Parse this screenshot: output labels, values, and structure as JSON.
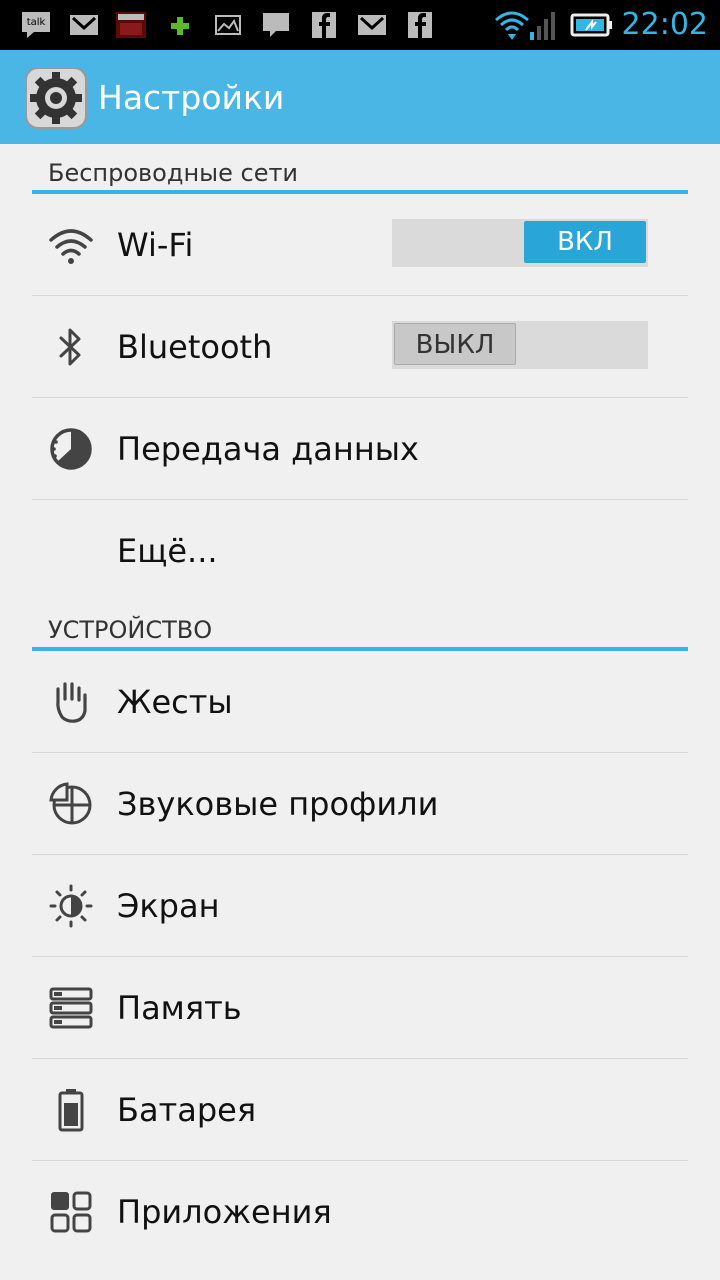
{
  "status_bar": {
    "time": "22:02",
    "accent": "#33b5e5",
    "notifications": [
      "talk-icon",
      "gmail-icon",
      "video-icon",
      "plus-icon",
      "gallery-icon",
      "message-icon",
      "facebook-icon",
      "gmail-icon",
      "facebook-icon"
    ]
  },
  "action_bar": {
    "title": "Настройки",
    "color": "#4ab6e6"
  },
  "sections": {
    "wireless": {
      "header": "Беспроводные сети",
      "wifi": {
        "label": "Wi-Fi",
        "toggle": "ВКЛ",
        "state": "on"
      },
      "bluetooth": {
        "label": "Bluetooth",
        "toggle": "ВЫКЛ",
        "state": "off"
      },
      "data": {
        "label": "Передача данных"
      },
      "more": {
        "label": "Ещё..."
      }
    },
    "device": {
      "header": "УСТРОЙСТВО",
      "gestures": {
        "label": "Жесты"
      },
      "sound": {
        "label": "Звуковые профили"
      },
      "screen": {
        "label": "Экран"
      },
      "memory": {
        "label": "Память"
      },
      "battery": {
        "label": "Батарея"
      },
      "apps": {
        "label": "Приложения"
      }
    }
  }
}
